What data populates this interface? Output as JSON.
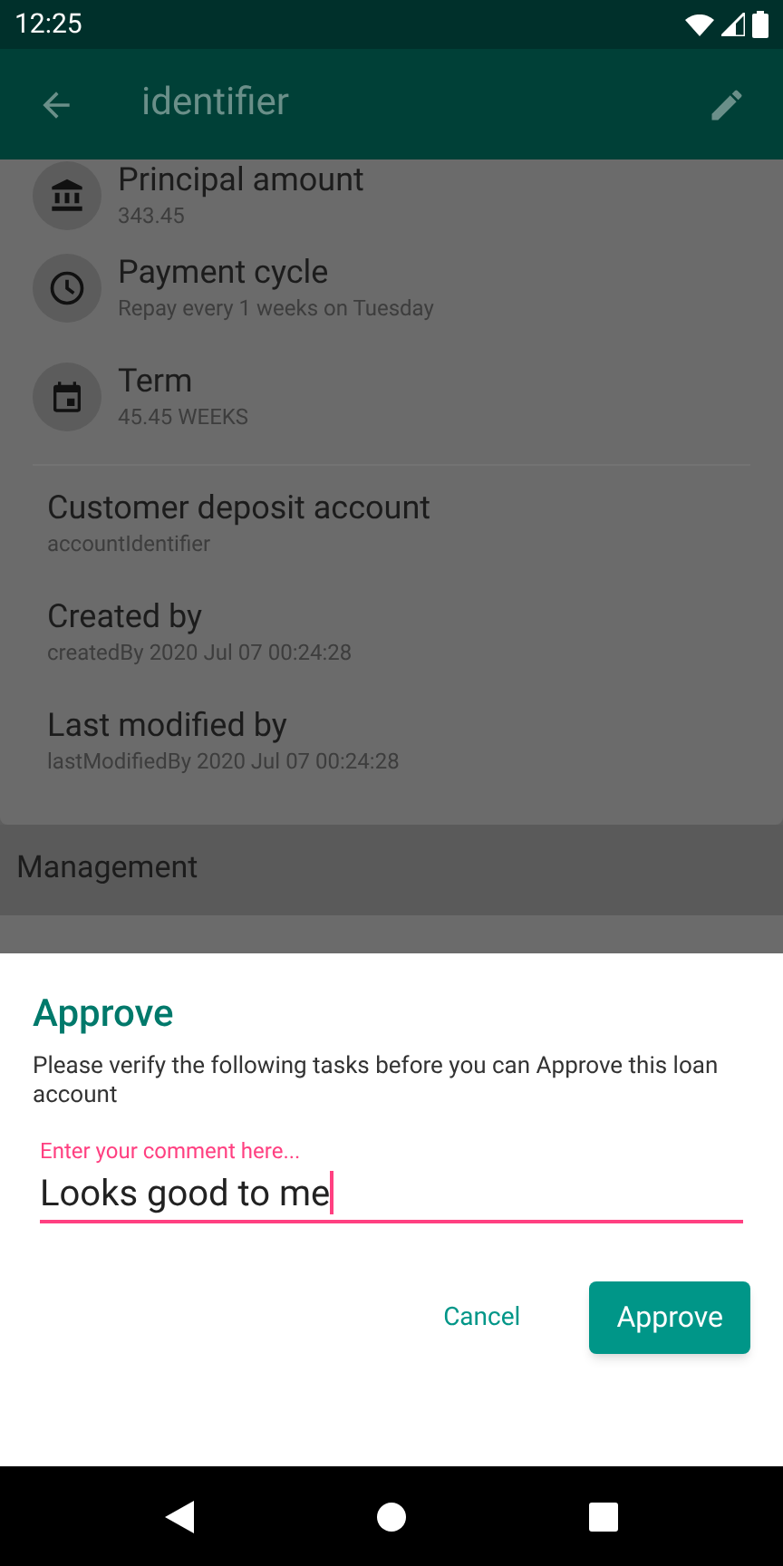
{
  "status_bar": {
    "time": "12:25"
  },
  "app_bar": {
    "title": "identifier"
  },
  "icon_rows": [
    {
      "title": "Principal amount",
      "subtitle": "343.45"
    },
    {
      "title": "Payment cycle",
      "subtitle": "Repay every 1 weeks on Tuesday"
    },
    {
      "title": "Term",
      "subtitle": "45.45 WEEKS"
    }
  ],
  "info_rows": [
    {
      "title": "Customer deposit account",
      "subtitle": "accountIdentifier"
    },
    {
      "title": "Created by",
      "subtitle": "createdBy 2020 Jul 07 00:24:28"
    },
    {
      "title": "Last modified by",
      "subtitle": "lastModifiedBy 2020 Jul 07 00:24:28"
    }
  ],
  "section": {
    "title": "Management"
  },
  "dialog": {
    "title": "Approve",
    "message": "Please verify the following tasks before you can Approve this loan account",
    "comment_field": {
      "placeholder": "Enter your comment here...",
      "value": "Looks good to me",
      "focused": true
    },
    "buttons": [
      {
        "label": "Cancel",
        "kind": "text"
      },
      {
        "label": "Approve",
        "kind": "filled"
      }
    ]
  }
}
